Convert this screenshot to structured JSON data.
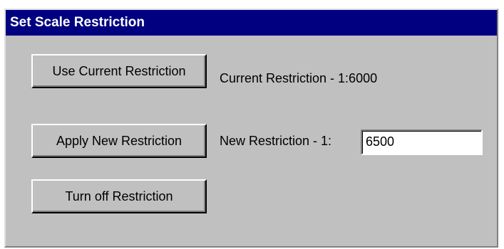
{
  "dialog": {
    "title": "Set Scale Restriction"
  },
  "buttons": {
    "use_current": "Use Current Restriction",
    "apply_new": "Apply New Restriction",
    "turn_off": "Turn off Restriction"
  },
  "labels": {
    "current_restriction": "Current Restriction - 1:6000",
    "new_restriction": "New Restriction - 1:"
  },
  "inputs": {
    "new_restriction_value": "6500"
  },
  "colors": {
    "titlebar": "#000080",
    "face": "#c0c0c0"
  }
}
